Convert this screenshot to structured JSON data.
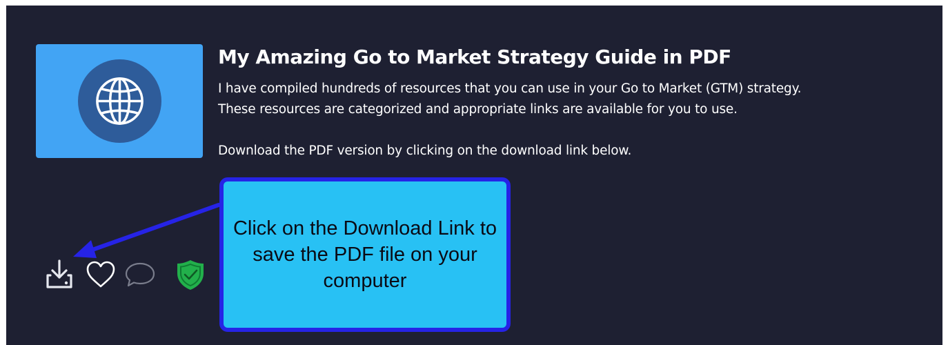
{
  "resource": {
    "title": "My Amazing Go to Market Strategy Guide in PDF",
    "description_lines": [
      "I have compiled hundreds of resources that you can use in your Go to Market (GTM) strategy.",
      "These resources are categorized and appropriate links are available for you to use.",
      "Download the PDF version by clicking on the download link below."
    ],
    "thumbnail_icon": "globe-icon"
  },
  "actions": [
    {
      "name": "download-icon",
      "color": "#e6e8ef"
    },
    {
      "name": "heart-icon",
      "color": "#ffffff"
    },
    {
      "name": "comment-icon",
      "color": "#7a7d8c"
    },
    {
      "name": "shield-check-icon",
      "color": "#22b04b"
    }
  ],
  "callout": {
    "text": "Click on the Download Link to save the PDF file on your computer"
  },
  "colors": {
    "card_bg": "#1e2032",
    "thumbnail_bg": "#42a4f4",
    "thumbnail_circle": "#2e5c9a",
    "callout_bg": "#28c1f4",
    "callout_border": "#2623e6",
    "arrow": "#2623e6"
  }
}
